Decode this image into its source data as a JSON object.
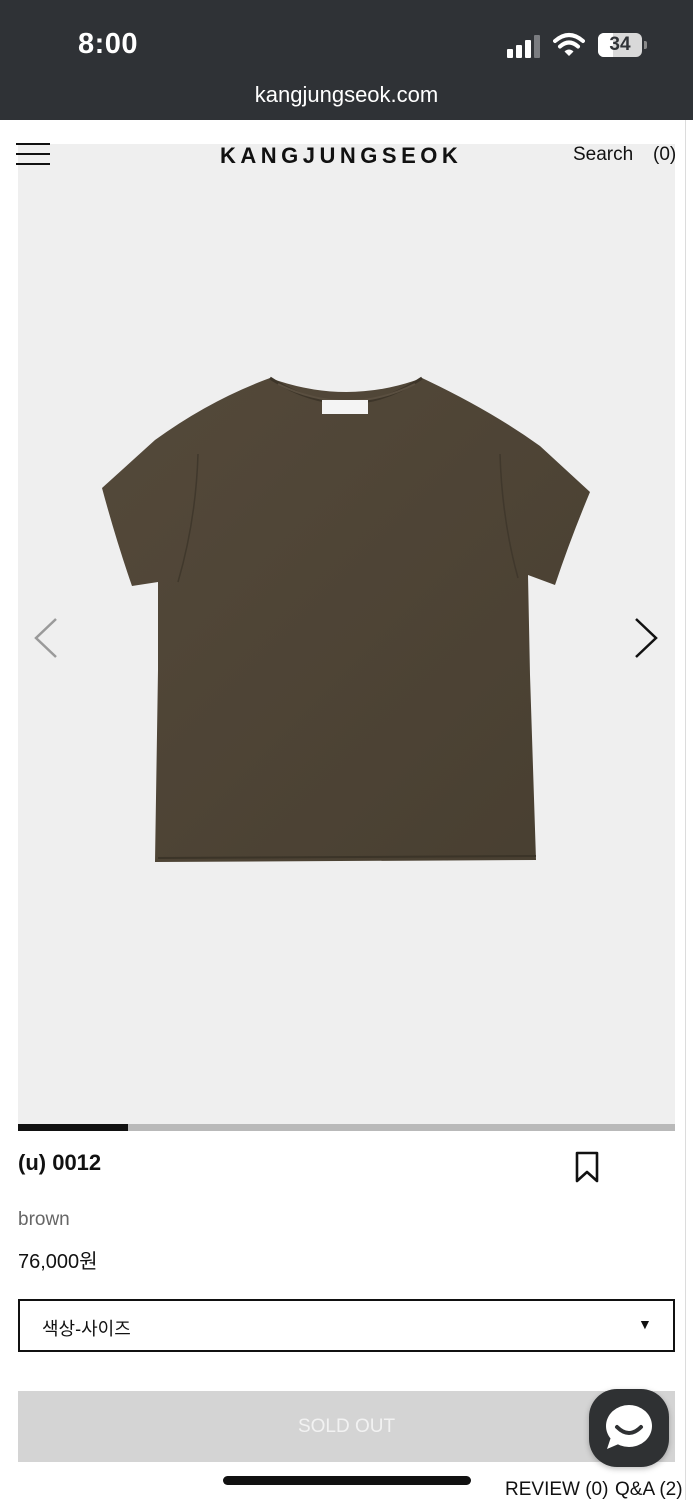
{
  "status_bar": {
    "time": "8:00",
    "battery": "34",
    "battery_fraction": 0.34,
    "signal_bars": 3
  },
  "browser": {
    "url": "kangjungseok.com"
  },
  "header": {
    "logo": "KANGJUNGSEOK",
    "search_label": "Search",
    "cart_count": "(0)"
  },
  "gallery": {
    "progress_fraction": 0.167,
    "background_color": "#efefef",
    "product_color": "#4e4536"
  },
  "product": {
    "name": "(u) 0012",
    "color": "brown",
    "price": "76,000원"
  },
  "option": {
    "placeholder": "색상-사이즈"
  },
  "buy_button": {
    "label": "SOLD OUT"
  },
  "tabs": {
    "review": "REVIEW (0)",
    "qna": "Q&A (2)"
  },
  "icons": {
    "menu": "hamburger-icon",
    "prev": "chevron-left-icon",
    "next": "chevron-right-icon",
    "wishlist": "bookmark-icon",
    "chat": "chat-icon"
  }
}
